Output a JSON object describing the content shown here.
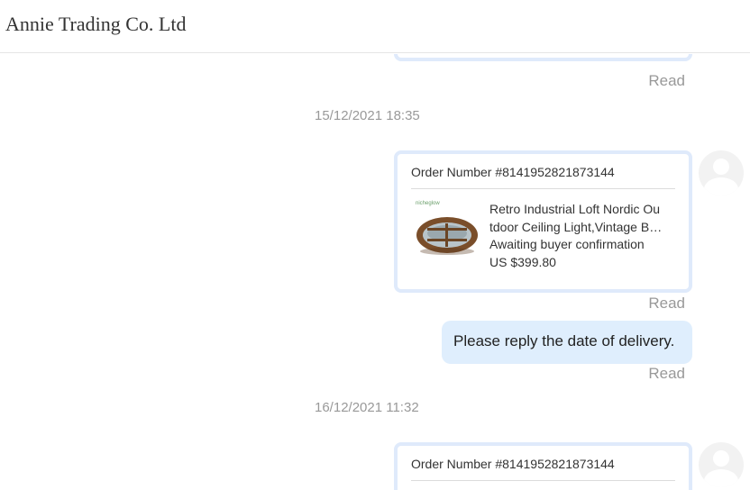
{
  "header": {
    "title": "Annie Trading Co. Ltd"
  },
  "messages": {
    "read_label": "Read",
    "timestamps": [
      "15/12/2021 18:35",
      "16/12/2021 11:32"
    ],
    "order1": {
      "order_number": "Order Number #8141952821873144",
      "product_line1": "Retro Industrial Loft Nordic Ou",
      "product_line2": "tdoor Ceiling Light,Vintage B…",
      "status": "Awaiting buyer confirmation",
      "price": "US $399.80",
      "thumb_tag": "nicheglow"
    },
    "text_message": "Please reply the date of delivery.",
    "order2": {
      "order_number": "Order Number #8141952821873144"
    }
  },
  "colors": {
    "card_border": "#dfeafb",
    "bubble_bg": "#dfeefd",
    "muted_text": "#999999"
  }
}
